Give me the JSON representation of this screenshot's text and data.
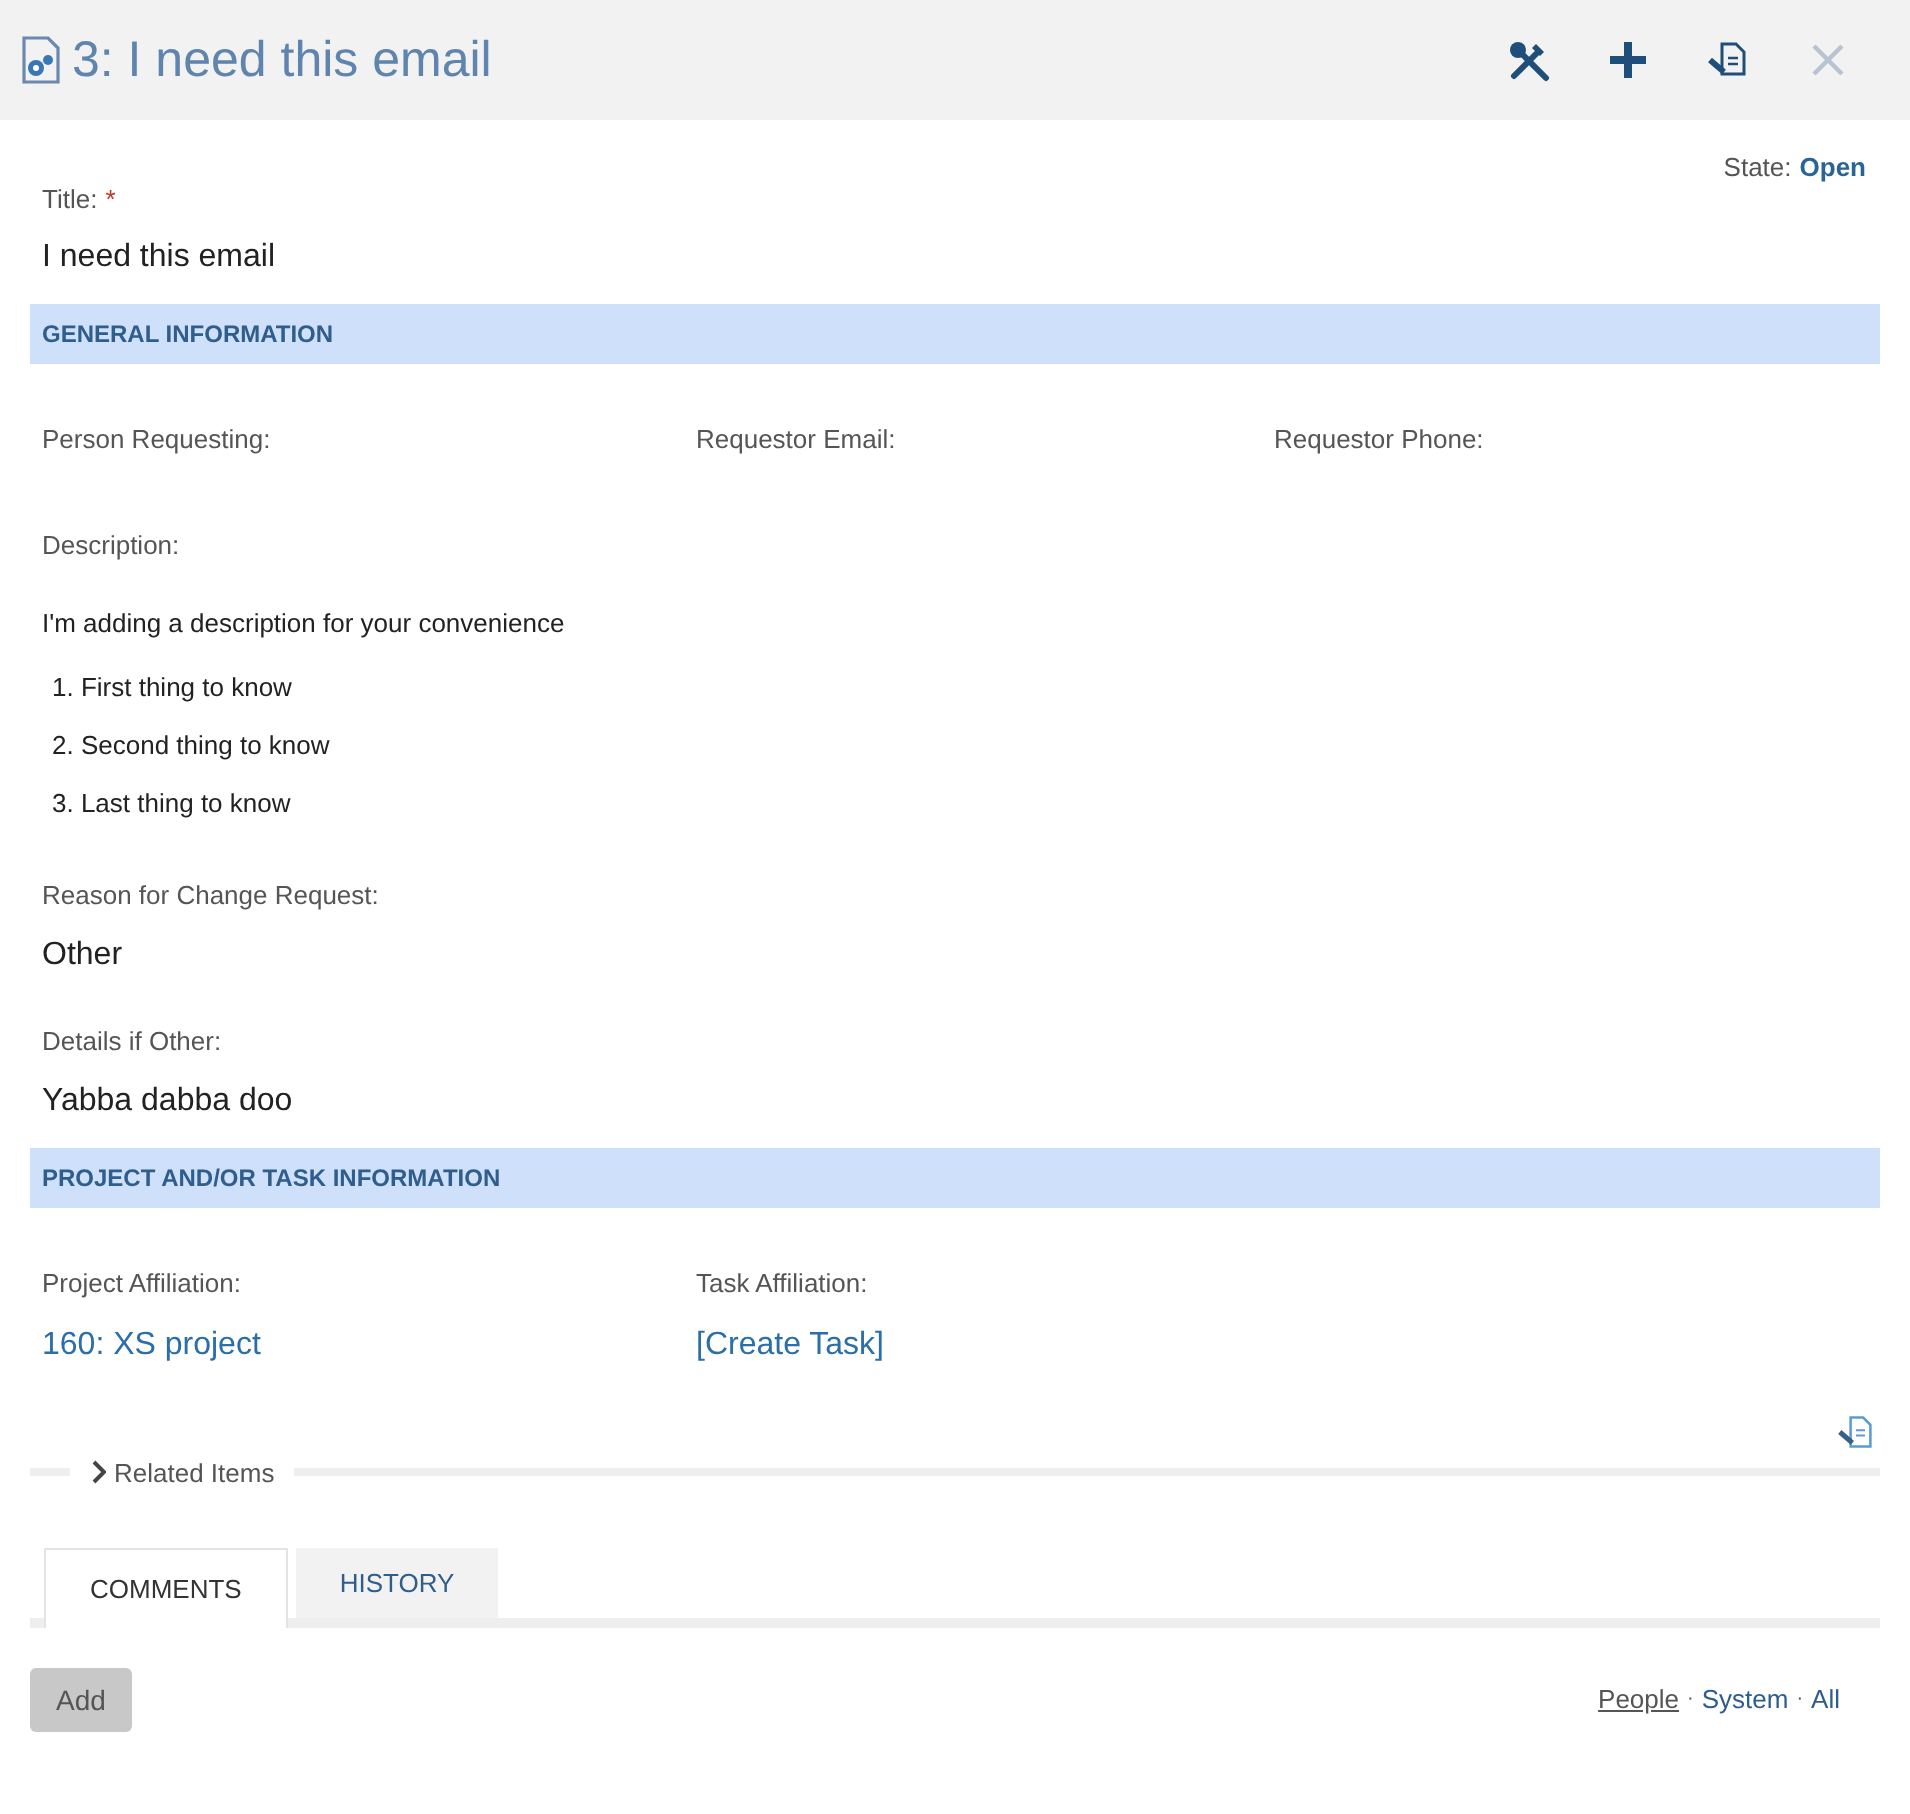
{
  "header": {
    "title": "3: I need this email",
    "toolbar": [
      {
        "kind": "tools",
        "disabled": false
      },
      {
        "kind": "add",
        "disabled": false
      },
      {
        "kind": "document",
        "disabled": false
      },
      {
        "kind": "close",
        "disabled": true
      }
    ]
  },
  "state": {
    "label": "State:",
    "value": "Open"
  },
  "title_field": {
    "label": "Title:",
    "required_mark": "*",
    "value": "I need this email"
  },
  "sections": [
    {
      "heading": "GENERAL INFORMATION",
      "kind": "general",
      "fields": [
        {
          "label": "Person Requesting:"
        },
        {
          "label": "Requestor Email:"
        },
        {
          "label": "Requestor Phone:"
        }
      ],
      "description": {
        "label": "Description:",
        "intro": "I'm adding a description for your convenience",
        "items": [
          {
            "number": "1.",
            "text": "First thing to know"
          },
          {
            "number": "2.",
            "text": "Second thing to know"
          },
          {
            "number": "3.",
            "text": "Last thing to know"
          }
        ]
      },
      "extra": [
        {
          "label": "Reason for Change Request:",
          "value": "Other"
        },
        {
          "label": "Details if Other:",
          "value": "Yabba dabba doo"
        }
      ]
    },
    {
      "heading": "PROJECT AND/OR TASK INFORMATION",
      "kind": "project",
      "fields": [
        {
          "label": "Project Affiliation:",
          "value": "160: XS project"
        },
        {
          "label": "Task Affiliation:",
          "value": "[Create Task]"
        }
      ]
    }
  ],
  "related": {
    "label": "Related Items",
    "expanded": false
  },
  "tabs": [
    {
      "label": "COMMENTS",
      "selected": true
    },
    {
      "label": "HISTORY",
      "selected": false
    }
  ],
  "add_button": "Add",
  "filters": [
    {
      "label": "People",
      "selected": true
    },
    {
      "label": "System",
      "selected": false
    },
    {
      "label": "All",
      "selected": false
    }
  ],
  "filter_separator": "·"
}
